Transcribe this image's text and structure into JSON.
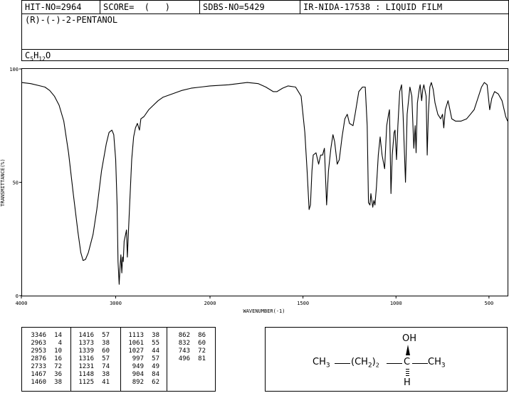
{
  "header": {
    "hit_no": "HIT-NO=2964",
    "score": "SCORE=  (   )",
    "sdbs_no": "SDBS-NO=5429",
    "method": "IR-NIDA-17538 : LIQUID FILM"
  },
  "compound_name": "(R)-(-)-2-PENTANOL",
  "formula": {
    "c": "C",
    "c_sub": "5",
    "h": "H",
    "h_sub": "12",
    "o": "O"
  },
  "chart_data": {
    "type": "line",
    "xlabel": "WAVENUMBER(-1)",
    "ylabel": "TRANSMITTANCE(%)",
    "xlim": [
      4000,
      400
    ],
    "ylim": [
      0,
      100
    ],
    "x_ticks": [
      4000,
      3000,
      2000,
      1500,
      1000,
      500
    ],
    "y_ticks": [
      0,
      50,
      100
    ],
    "grid": false,
    "series": [
      {
        "points": [
          [
            4000,
            94
          ],
          [
            3900,
            93.5
          ],
          [
            3800,
            92.5
          ],
          [
            3750,
            92
          ],
          [
            3700,
            90.5
          ],
          [
            3650,
            88
          ],
          [
            3600,
            84
          ],
          [
            3550,
            77
          ],
          [
            3500,
            63
          ],
          [
            3450,
            45
          ],
          [
            3400,
            28
          ],
          [
            3370,
            19
          ],
          [
            3346,
            15.5
          ],
          [
            3320,
            16
          ],
          [
            3290,
            19
          ],
          [
            3240,
            27
          ],
          [
            3200,
            38
          ],
          [
            3150,
            55
          ],
          [
            3100,
            67
          ],
          [
            3070,
            72
          ],
          [
            3040,
            73
          ],
          [
            3020,
            71
          ],
          [
            3000,
            60
          ],
          [
            2985,
            40
          ],
          [
            2975,
            15
          ],
          [
            2963,
            5
          ],
          [
            2955,
            12
          ],
          [
            2945,
            18
          ],
          [
            2935,
            10
          ],
          [
            2927,
            17
          ],
          [
            2920,
            15
          ],
          [
            2910,
            24
          ],
          [
            2895,
            27
          ],
          [
            2885,
            29
          ],
          [
            2876,
            17
          ],
          [
            2865,
            28
          ],
          [
            2850,
            42
          ],
          [
            2830,
            60
          ],
          [
            2810,
            70
          ],
          [
            2790,
            74
          ],
          [
            2770,
            76
          ],
          [
            2748,
            73
          ],
          [
            2733,
            78
          ],
          [
            2700,
            79
          ],
          [
            2650,
            82
          ],
          [
            2600,
            84
          ],
          [
            2550,
            86
          ],
          [
            2500,
            87.5
          ],
          [
            2400,
            89
          ],
          [
            2300,
            90.5
          ],
          [
            2200,
            91.5
          ],
          [
            2100,
            92
          ],
          [
            2000,
            92.5
          ],
          [
            1900,
            93
          ],
          [
            1800,
            94
          ],
          [
            1740,
            93.5
          ],
          [
            1700,
            92
          ],
          [
            1660,
            90
          ],
          [
            1640,
            90
          ],
          [
            1610,
            91.5
          ],
          [
            1580,
            92.5
          ],
          [
            1540,
            92
          ],
          [
            1510,
            88
          ],
          [
            1490,
            72
          ],
          [
            1478,
            55
          ],
          [
            1467,
            38
          ],
          [
            1460,
            40
          ],
          [
            1452,
            55
          ],
          [
            1445,
            62
          ],
          [
            1430,
            63
          ],
          [
            1416,
            58
          ],
          [
            1405,
            62
          ],
          [
            1395,
            62
          ],
          [
            1385,
            65
          ],
          [
            1373,
            40
          ],
          [
            1363,
            55
          ],
          [
            1350,
            65
          ],
          [
            1339,
            71
          ],
          [
            1330,
            68
          ],
          [
            1316,
            58
          ],
          [
            1305,
            60
          ],
          [
            1290,
            70
          ],
          [
            1275,
            78
          ],
          [
            1262,
            80
          ],
          [
            1250,
            76
          ],
          [
            1231,
            75
          ],
          [
            1220,
            80
          ],
          [
            1200,
            90
          ],
          [
            1180,
            92
          ],
          [
            1165,
            92
          ],
          [
            1155,
            75
          ],
          [
            1148,
            41
          ],
          [
            1140,
            40
          ],
          [
            1135,
            45
          ],
          [
            1125,
            39
          ],
          [
            1119,
            42
          ],
          [
            1113,
            40
          ],
          [
            1105,
            48
          ],
          [
            1095,
            62
          ],
          [
            1085,
            70
          ],
          [
            1075,
            62
          ],
          [
            1061,
            56
          ],
          [
            1050,
            75
          ],
          [
            1040,
            80
          ],
          [
            1035,
            82
          ],
          [
            1027,
            45
          ],
          [
            1020,
            62
          ],
          [
            1010,
            72
          ],
          [
            1005,
            73
          ],
          [
            997,
            60
          ],
          [
            990,
            75
          ],
          [
            980,
            90
          ],
          [
            970,
            93
          ],
          [
            962,
            80
          ],
          [
            949,
            50
          ],
          [
            940,
            80
          ],
          [
            930,
            88
          ],
          [
            925,
            92
          ],
          [
            915,
            88
          ],
          [
            904,
            65
          ],
          [
            897,
            75
          ],
          [
            892,
            63
          ],
          [
            885,
            85
          ],
          [
            875,
            91
          ],
          [
            870,
            93
          ],
          [
            862,
            86
          ],
          [
            856,
            91
          ],
          [
            850,
            93
          ],
          [
            843,
            90
          ],
          [
            838,
            88
          ],
          [
            832,
            62
          ],
          [
            826,
            80
          ],
          [
            818,
            92
          ],
          [
            810,
            94
          ],
          [
            800,
            91
          ],
          [
            790,
            85
          ],
          [
            775,
            80
          ],
          [
            760,
            78
          ],
          [
            750,
            80
          ],
          [
            743,
            74
          ],
          [
            735,
            82
          ],
          [
            720,
            86
          ],
          [
            710,
            82
          ],
          [
            700,
            78
          ],
          [
            680,
            77
          ],
          [
            650,
            77
          ],
          [
            620,
            78
          ],
          [
            600,
            80
          ],
          [
            580,
            82
          ],
          [
            560,
            87
          ],
          [
            540,
            92
          ],
          [
            525,
            94
          ],
          [
            510,
            93
          ],
          [
            496,
            82
          ],
          [
            485,
            87
          ],
          [
            470,
            90
          ],
          [
            450,
            89
          ],
          [
            430,
            86
          ],
          [
            410,
            79
          ],
          [
            400,
            77
          ]
        ]
      }
    ]
  },
  "peak_table": {
    "columns": [
      [
        [
          "3346",
          "14"
        ],
        [
          "2963",
          "4"
        ],
        [
          "2953",
          "10"
        ],
        [
          "2876",
          "16"
        ],
        [
          "2733",
          "72"
        ],
        [
          "1467",
          "36"
        ],
        [
          "1460",
          "38"
        ]
      ],
      [
        [
          "1416",
          "57"
        ],
        [
          "1373",
          "38"
        ],
        [
          "1339",
          "60"
        ],
        [
          "1316",
          "57"
        ],
        [
          "1231",
          "74"
        ],
        [
          "1148",
          "38"
        ],
        [
          "1125",
          "41"
        ]
      ],
      [
        [
          "1113",
          "38"
        ],
        [
          "1061",
          "55"
        ],
        [
          "1027",
          "44"
        ],
        [
          "997",
          "57"
        ],
        [
          "949",
          "49"
        ],
        [
          "904",
          "84"
        ],
        [
          "892",
          "62"
        ]
      ],
      [
        [
          "862",
          "86"
        ],
        [
          "832",
          "60"
        ],
        [
          "743",
          "72"
        ],
        [
          "496",
          "81"
        ]
      ]
    ]
  },
  "structure": {
    "oh": "OH",
    "left": "CH",
    "left_sub": "3",
    "mid_open": "(CH",
    "mid_sub": "2",
    "mid_close": ")",
    "mid_count": "2",
    "center": "C",
    "right": "CH",
    "right_sub": "3",
    "h": "H"
  }
}
